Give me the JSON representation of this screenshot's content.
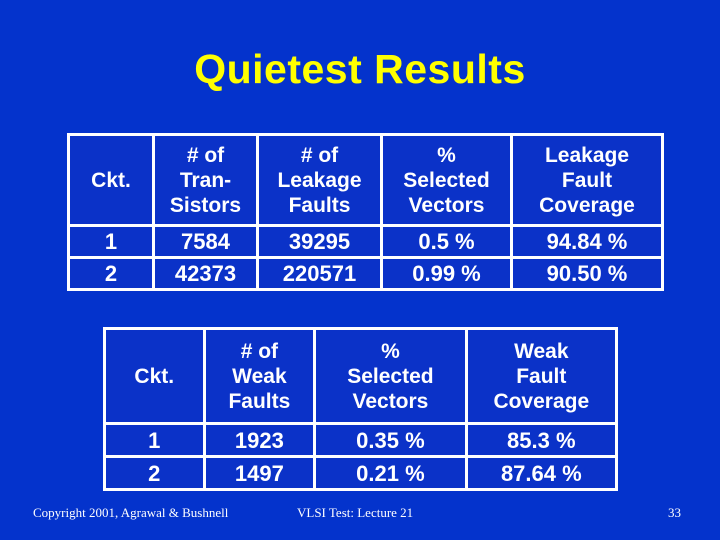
{
  "slide": {
    "title": "Quietest Results",
    "background_color": "#0433cc",
    "title_color": "#ffff00",
    "text_color": "#ffffff",
    "cell_color": "#0b32c8",
    "border_color": "#ffffff"
  },
  "table_leakage": {
    "headers": [
      {
        "lines": [
          "Ckt."
        ]
      },
      {
        "lines": [
          "# of",
          "Tran-",
          "Sistors"
        ]
      },
      {
        "lines": [
          "# of",
          "Leakage",
          "Faults"
        ]
      },
      {
        "lines": [
          "%",
          "Selected",
          "Vectors"
        ]
      },
      {
        "lines": [
          "Leakage",
          "Fault",
          "Coverage"
        ]
      }
    ],
    "rows": [
      [
        "1",
        "7584",
        "39295",
        "0.5 %",
        "94.84 %"
      ],
      [
        "2",
        "42373",
        "220571",
        "0.99 %",
        "90.50 %"
      ]
    ]
  },
  "table_weak": {
    "headers": [
      {
        "lines": [
          "Ckt."
        ]
      },
      {
        "lines": [
          "# of",
          "Weak",
          "Faults"
        ]
      },
      {
        "lines": [
          "%",
          "Selected",
          "Vectors"
        ]
      },
      {
        "lines": [
          "Weak",
          "Fault",
          "Coverage"
        ]
      }
    ],
    "rows": [
      [
        "1",
        "1923",
        "0.35 %",
        "85.3 %"
      ],
      [
        "2",
        "1497",
        "0.21 %",
        "87.64 %"
      ]
    ]
  },
  "footer": {
    "copyright": "Copyright 2001, Agrawal & Bushnell",
    "lecture": "VLSI Test: Lecture 21",
    "page_number": "33"
  }
}
